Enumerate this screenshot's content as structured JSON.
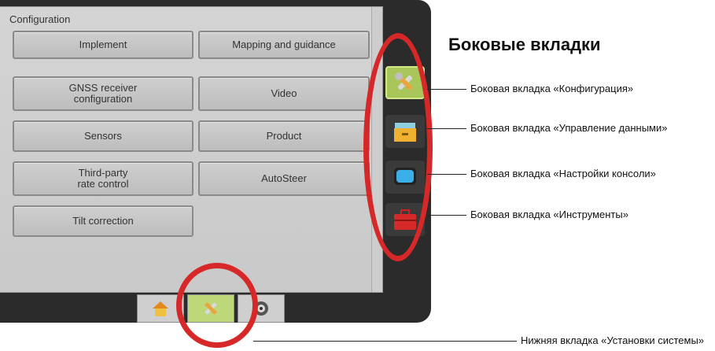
{
  "screen": {
    "title": "Configuration",
    "buttons": {
      "implement": "Implement",
      "mapping": "Mapping and guidance",
      "gnss": "GNSS receiver\nconfiguration",
      "video": "Video",
      "sensors": "Sensors",
      "product": "Product",
      "third_party": "Third-party\nrate control",
      "autosteer": "AutoSteer",
      "tilt": "Tilt correction"
    }
  },
  "side_tabs": [
    {
      "icon": "tools-wrench-icon",
      "active": true
    },
    {
      "icon": "data-folder-icon",
      "active": false
    },
    {
      "icon": "console-screen-icon",
      "active": false
    },
    {
      "icon": "toolbox-icon",
      "active": false
    }
  ],
  "bottom_tabs": [
    {
      "icon": "home-icon",
      "active": false
    },
    {
      "icon": "tools-wrench-icon",
      "active": true
    },
    {
      "icon": "camera-icon",
      "active": false
    }
  ],
  "annotations": {
    "heading": "Боковые вкладки",
    "side_config": "Боковая вкладка «Конфигурация»",
    "side_data": "Боковая вкладка «Управление данными»",
    "side_console": "Боковая вкладка «Настройки консоли»",
    "side_tools": "Боковая вкладка «Инструменты»",
    "bottom_system": "Нижняя вкладка «Установки системы»"
  },
  "colors": {
    "ring": "#d62828",
    "active_tab": "#a8c65a",
    "frame": "#2b2b2b"
  }
}
